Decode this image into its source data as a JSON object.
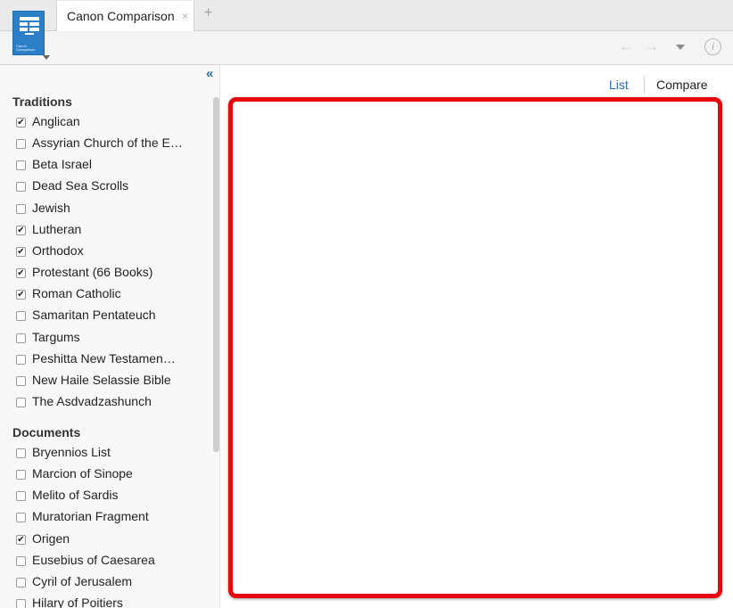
{
  "app": {
    "icon_caption": "Canon Comparison"
  },
  "tab": {
    "label": "Canon Comparison",
    "close": "×",
    "add": "+"
  },
  "toolbar": {
    "back_icon": "←",
    "forward_icon": "→",
    "info_icon": "i"
  },
  "sidebar": {
    "collapse": "«",
    "traditions_heading": "Traditions",
    "traditions": [
      {
        "label": "Anglican",
        "checked": true
      },
      {
        "label": "Assyrian Church of the E…",
        "checked": false
      },
      {
        "label": "Beta Israel",
        "checked": false
      },
      {
        "label": "Dead Sea Scrolls",
        "checked": false
      },
      {
        "label": "Jewish",
        "checked": false
      },
      {
        "label": "Lutheran",
        "checked": true
      },
      {
        "label": "Orthodox",
        "checked": true
      },
      {
        "label": "Protestant (66 Books)",
        "checked": true
      },
      {
        "label": "Roman Catholic",
        "checked": true
      },
      {
        "label": "Samaritan Pentateuch",
        "checked": false
      },
      {
        "label": "Targums",
        "checked": false
      },
      {
        "label": "Peshitta New Testamen…",
        "checked": false
      },
      {
        "label": "New Haile Selassie Bible",
        "checked": false
      },
      {
        "label": "The Asdvadzashunch",
        "checked": false
      }
    ],
    "documents_heading": "Documents",
    "documents": [
      {
        "label": "Bryennios List",
        "checked": false
      },
      {
        "label": "Marcion of Sinope",
        "checked": false
      },
      {
        "label": "Melito of Sardis",
        "checked": false
      },
      {
        "label": "Muratorian Fragment",
        "checked": false
      },
      {
        "label": "Origen",
        "checked": true
      },
      {
        "label": "Eusebius of Caesarea",
        "checked": false
      },
      {
        "label": "Cyril of Jerusalem",
        "checked": false
      },
      {
        "label": "Hilary of Poitiers",
        "checked": false
      }
    ]
  },
  "main": {
    "list_label": "List",
    "compare_label": "Compare"
  },
  "colors": {
    "accent": "#2b6cb3",
    "highlight": "#e8050b",
    "app_icon": "#2a7fc6"
  }
}
